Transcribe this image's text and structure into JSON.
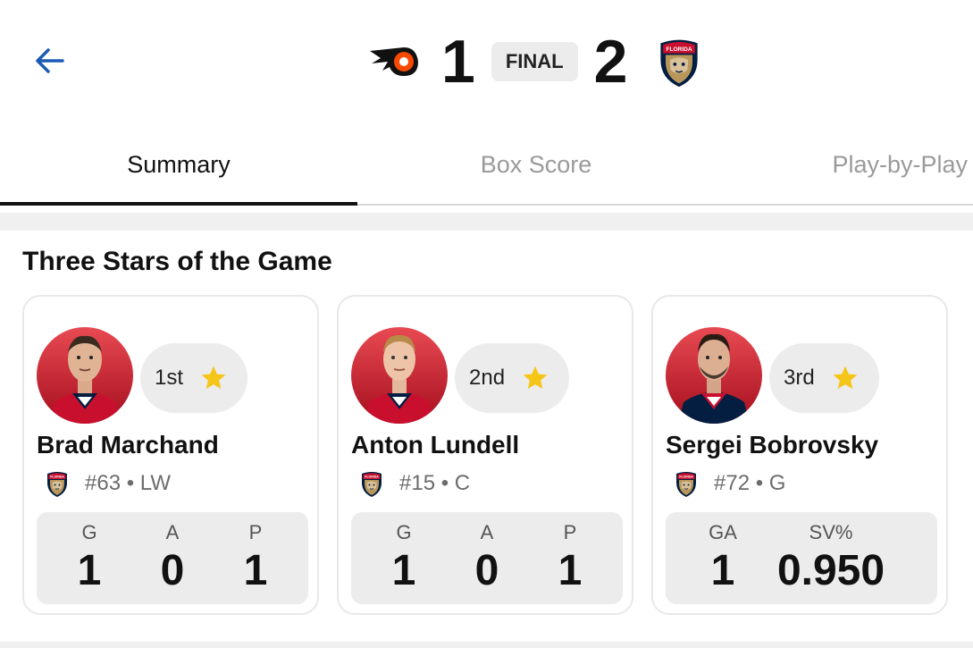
{
  "header": {
    "home_team": "Philadelphia Flyers",
    "away_team": "Florida Panthers",
    "home_score": "1",
    "away_score": "2",
    "status": "FINAL",
    "away_logo_text": "FLORIDA"
  },
  "tabs": [
    {
      "label": "Summary",
      "active": true
    },
    {
      "label": "Box Score",
      "active": false
    },
    {
      "label": "Play-by-Play",
      "active": false
    }
  ],
  "section": {
    "title": "Three Stars of the Game"
  },
  "stars": [
    {
      "rank": "1st",
      "name": "Brad Marchand",
      "meta": "#63 • LW",
      "stats": [
        {
          "label": "G",
          "value": "1"
        },
        {
          "label": "A",
          "value": "0"
        },
        {
          "label": "P",
          "value": "1"
        }
      ]
    },
    {
      "rank": "2nd",
      "name": "Anton Lundell",
      "meta": "#15 • C",
      "stats": [
        {
          "label": "G",
          "value": "1"
        },
        {
          "label": "A",
          "value": "0"
        },
        {
          "label": "P",
          "value": "1"
        }
      ]
    },
    {
      "rank": "3rd",
      "name": "Sergei Bobrovsky",
      "meta": "#72 • G",
      "stats": [
        {
          "label": "GA",
          "value": "1"
        },
        {
          "label": "SV%",
          "value": "0.950"
        }
      ]
    }
  ],
  "colors": {
    "accent_blue": "#1c5bb5",
    "star_yellow": "#f5c518",
    "panthers_red": "#c8102e",
    "panthers_navy": "#041e42",
    "flyers_orange": "#f74902"
  }
}
